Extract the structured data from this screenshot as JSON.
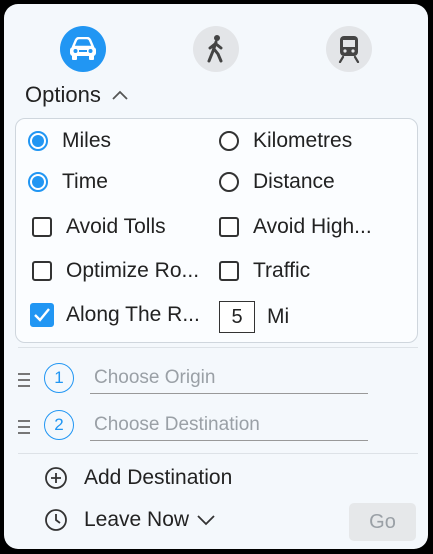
{
  "modes": [
    {
      "name": "car",
      "icon": "car-icon",
      "active": true
    },
    {
      "name": "walk",
      "icon": "walking-person-icon",
      "active": false
    },
    {
      "name": "transit",
      "icon": "train-icon",
      "active": false
    }
  ],
  "options": {
    "title": "Options",
    "units": {
      "miles": "Miles",
      "kilometres": "Kilometres",
      "selected": "miles"
    },
    "optimize_by": {
      "time": "Time",
      "distance": "Distance",
      "selected": "time"
    },
    "checkboxes": {
      "avoid_tolls": {
        "label": "Avoid Tolls",
        "checked": false
      },
      "avoid_highways": {
        "label": "Avoid High...",
        "checked": false
      },
      "optimize_route": {
        "label": "Optimize Ro...",
        "checked": false
      },
      "traffic": {
        "label": "Traffic",
        "checked": false
      },
      "along_route": {
        "label": "Along The R...",
        "checked": true
      }
    },
    "distance_value": "5",
    "distance_unit": "Mi"
  },
  "route": {
    "stops": [
      {
        "number": "1",
        "placeholder": "Choose Origin"
      },
      {
        "number": "2",
        "placeholder": "Choose Destination"
      }
    ]
  },
  "actions": {
    "add_destination": "Add Destination",
    "leave_now": "Leave Now",
    "go": "Go"
  },
  "colors": {
    "accent": "#2196f3",
    "inactive_icon_bg": "#e3e5e8"
  }
}
